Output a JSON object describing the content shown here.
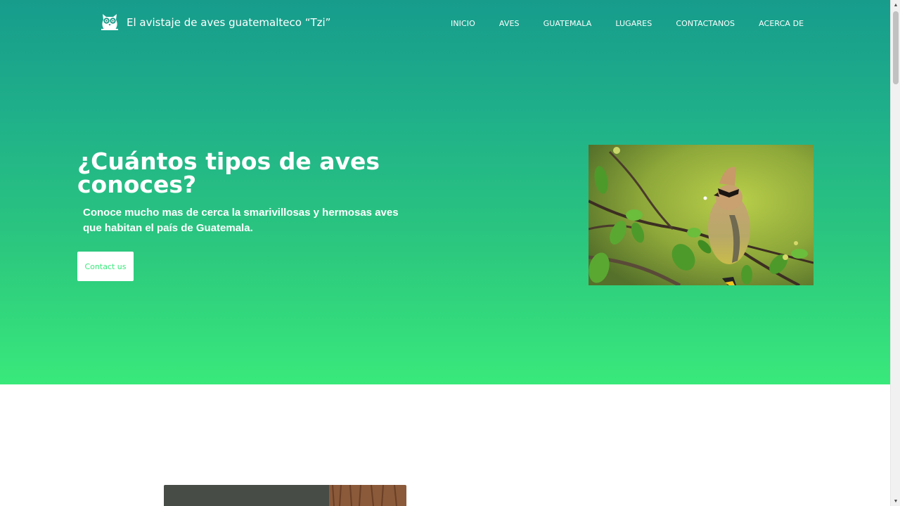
{
  "brand": {
    "name": "El avistaje de aves guatemalteco “Tzi”",
    "logo_icon": "owl-icon"
  },
  "nav": {
    "items": [
      "INICIO",
      "AVES",
      "GUATEMALA",
      "LUGARES",
      "CONTACTANOS",
      "ACERCA DE"
    ]
  },
  "hero": {
    "title": "¿Cuántos tipos de aves conoces?",
    "subtitle": "Conoce mucho mas de cerca la smarivillosas y hermosas aves que habitan el país de Guatemala.",
    "cta_label": "Contact us",
    "image_icon": "bird-photo"
  },
  "colors": {
    "gradient_top": "#179c8c",
    "gradient_bottom": "#39e97b",
    "cta_text": "#39e97b"
  },
  "scrollbar": {
    "up_icon": "scroll-up-arrow-icon",
    "down_icon": "scroll-down-arrow-icon"
  }
}
